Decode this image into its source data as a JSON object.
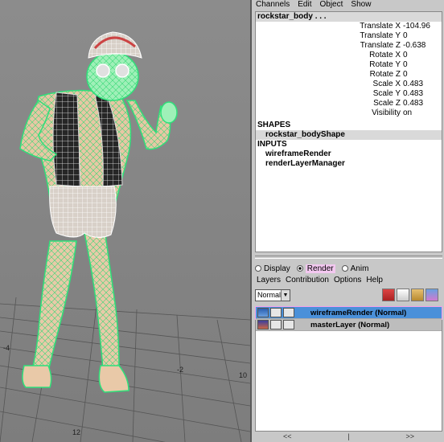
{
  "viewport": {
    "axis_labels": [
      "-4",
      "10",
      "12",
      "-2"
    ]
  },
  "menu": [
    "Channels",
    "Edit",
    "Object",
    "Show"
  ],
  "channel_box": {
    "object_name": "rockstar_body . . .",
    "attributes": [
      {
        "label": "Translate X",
        "value": "-104.96"
      },
      {
        "label": "Translate Y",
        "value": "0"
      },
      {
        "label": "Translate Z",
        "value": "-0.638"
      },
      {
        "label": "Rotate X",
        "value": "0"
      },
      {
        "label": "Rotate Y",
        "value": "0"
      },
      {
        "label": "Rotate Z",
        "value": "0"
      },
      {
        "label": "Scale X",
        "value": "0.483"
      },
      {
        "label": "Scale Y",
        "value": "0.483"
      },
      {
        "label": "Scale Z",
        "value": "0.483"
      },
      {
        "label": "Visibility",
        "value": "on"
      }
    ],
    "shapes_header": "SHAPES",
    "shapes": [
      "rockstar_bodyShape"
    ],
    "inputs_header": "INPUTS",
    "inputs": [
      "wireframeRender",
      "renderLayerManager"
    ]
  },
  "layer_editor": {
    "modes": [
      "Display",
      "Render",
      "Anim"
    ],
    "selected_mode": "Render",
    "menu": [
      "Layers",
      "Contribution",
      "Options",
      "Help"
    ],
    "blend_mode": "Normal",
    "layers": [
      {
        "name": "wireframeRender (Normal)",
        "selected": true
      },
      {
        "name": "masterLayer (Normal)",
        "selected": false
      }
    ],
    "footer": [
      "<<",
      "|",
      ">>"
    ]
  },
  "colors": {
    "wireframe": "#33e07a",
    "selected_layer": "#4a90d9",
    "highlight": "#f3a0ec"
  }
}
